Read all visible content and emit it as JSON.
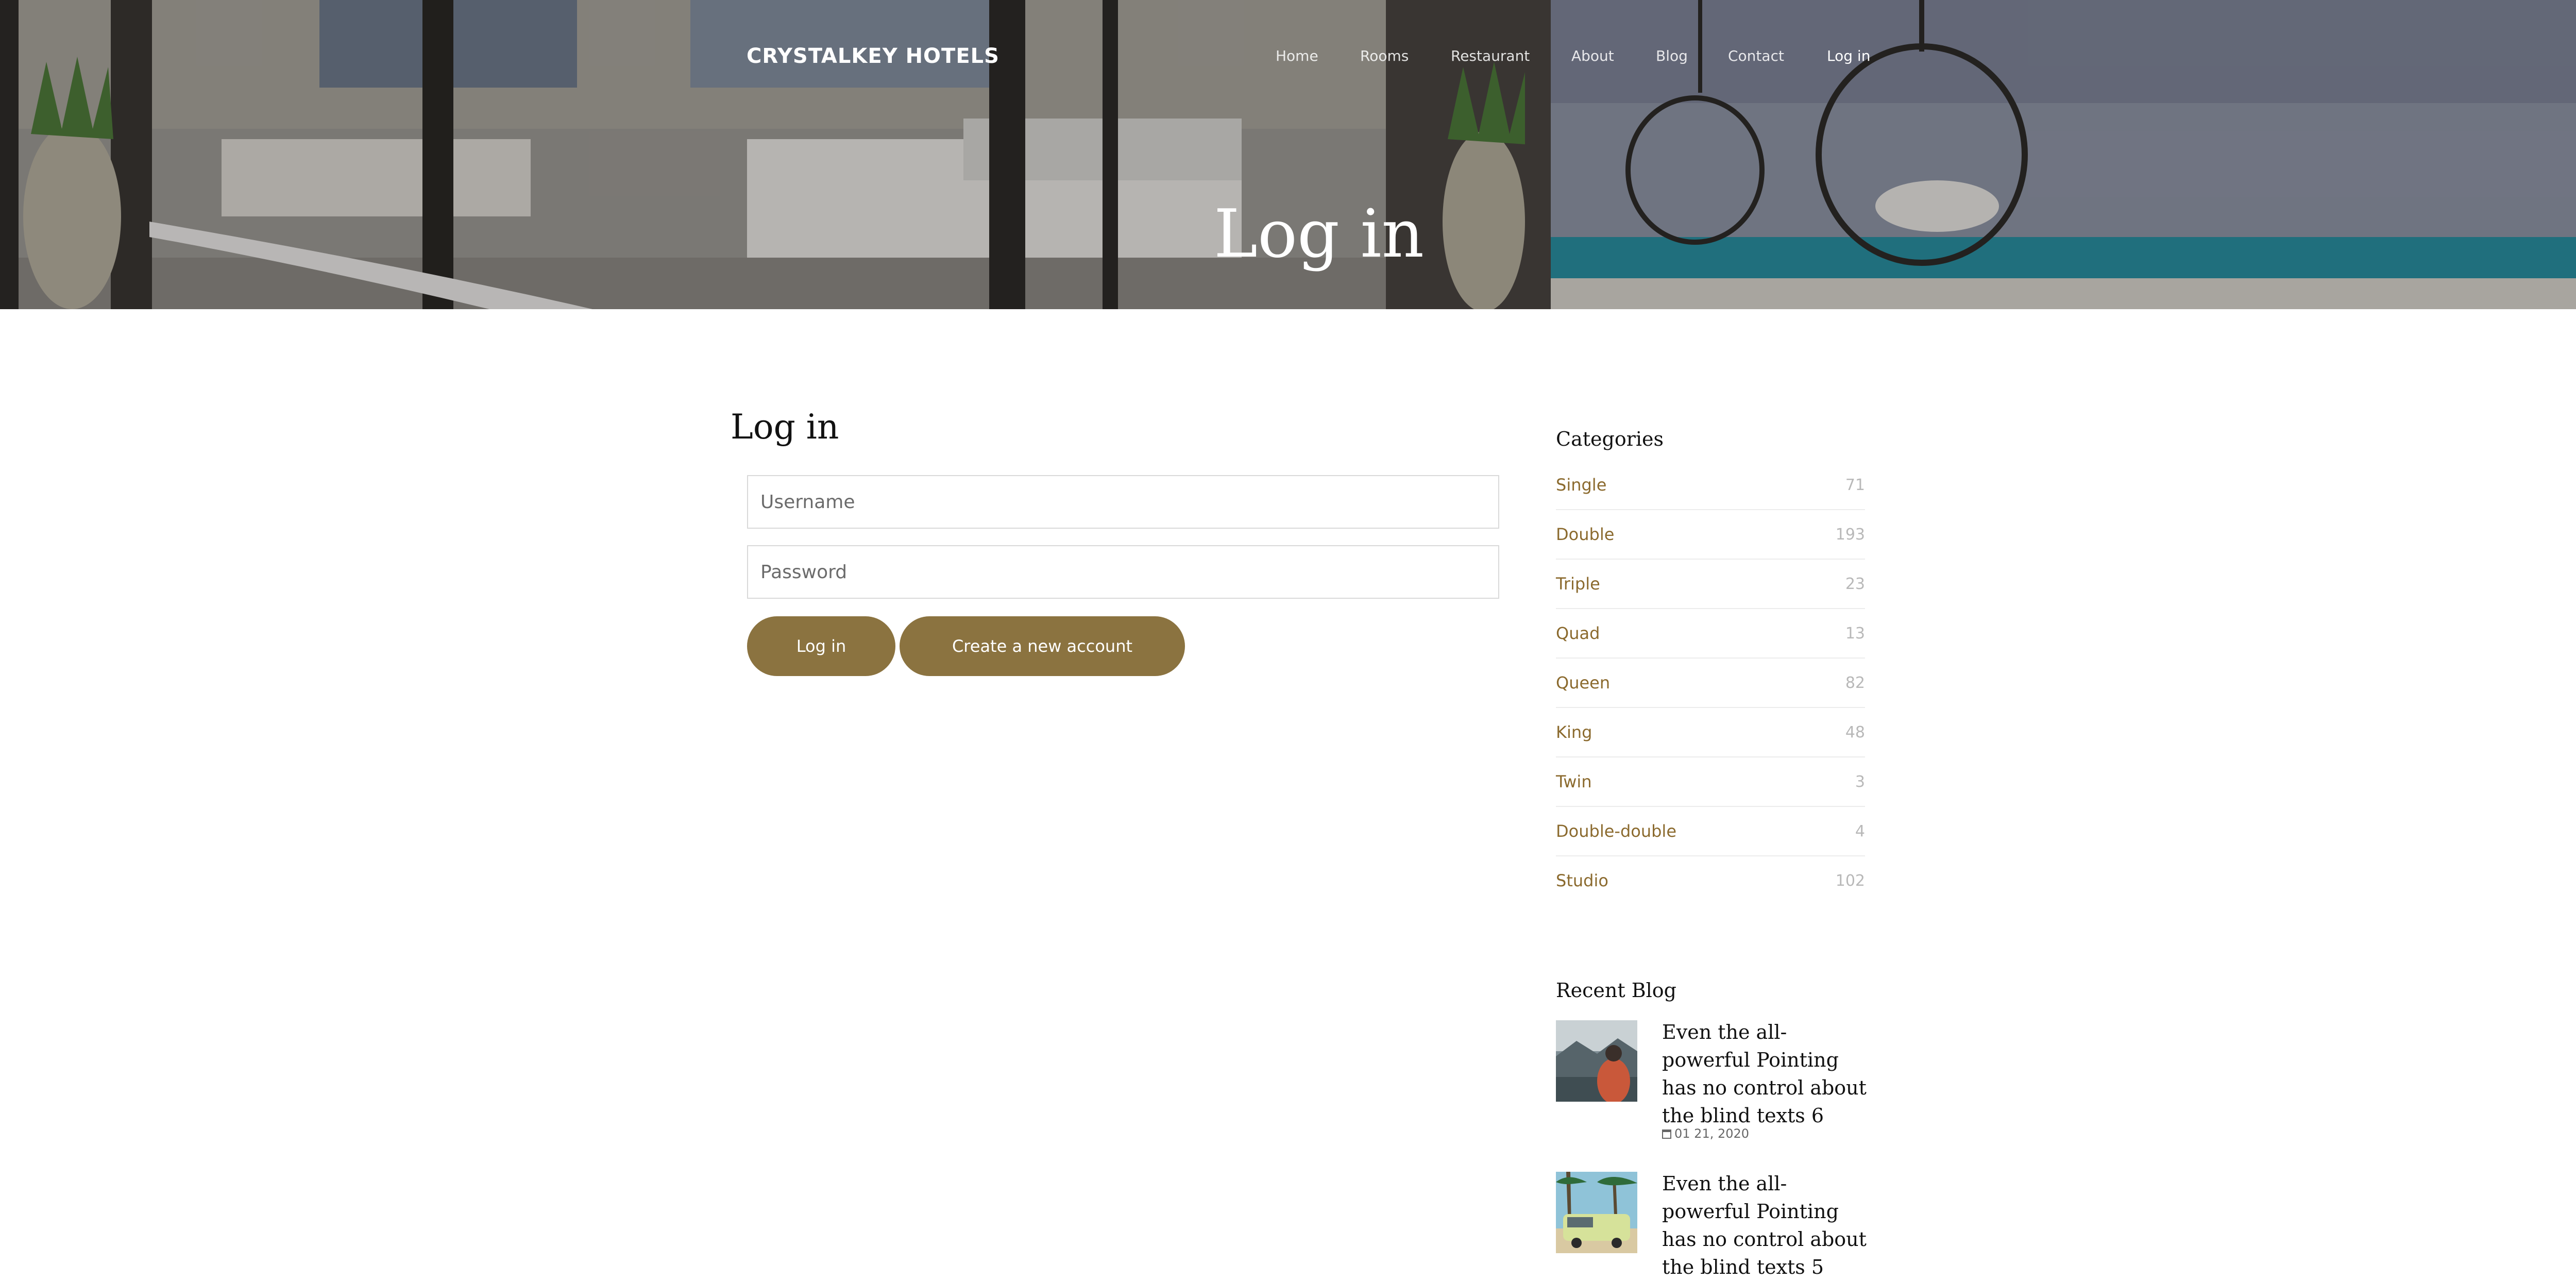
{
  "header": {
    "brand": "CRYSTALKEY HOTELS",
    "nav": [
      "Home",
      "Rooms",
      "Restaurant",
      "About",
      "Blog",
      "Contact",
      "Log in"
    ],
    "active_nav": "Log in",
    "hero_title": "Log in"
  },
  "login": {
    "title": "Log in",
    "username_placeholder": "Username",
    "password_placeholder": "Password",
    "login_button": "Log in",
    "create_account_button": "Create a new account",
    "button_color": "#8b7340"
  },
  "sidebar": {
    "categories_title": "Categories",
    "categories": [
      {
        "label": "Single",
        "count": "71"
      },
      {
        "label": "Double",
        "count": "193"
      },
      {
        "label": "Triple",
        "count": "23"
      },
      {
        "label": "Quad",
        "count": "13"
      },
      {
        "label": "Queen",
        "count": "82"
      },
      {
        "label": "King",
        "count": "48"
      },
      {
        "label": "Twin",
        "count": "3"
      },
      {
        "label": "Double-double",
        "count": "4"
      },
      {
        "label": "Studio",
        "count": "102"
      }
    ],
    "category_color": "#8b6a2e",
    "recent_blog_title": "Recent Blog",
    "recent_blog": [
      {
        "title": "Even the all-powerful Pointing has no control about the blind texts 6",
        "date": "01 21, 2020"
      },
      {
        "title": "Even the all-powerful Pointing has no control about the blind texts 5",
        "date": ""
      }
    ]
  }
}
